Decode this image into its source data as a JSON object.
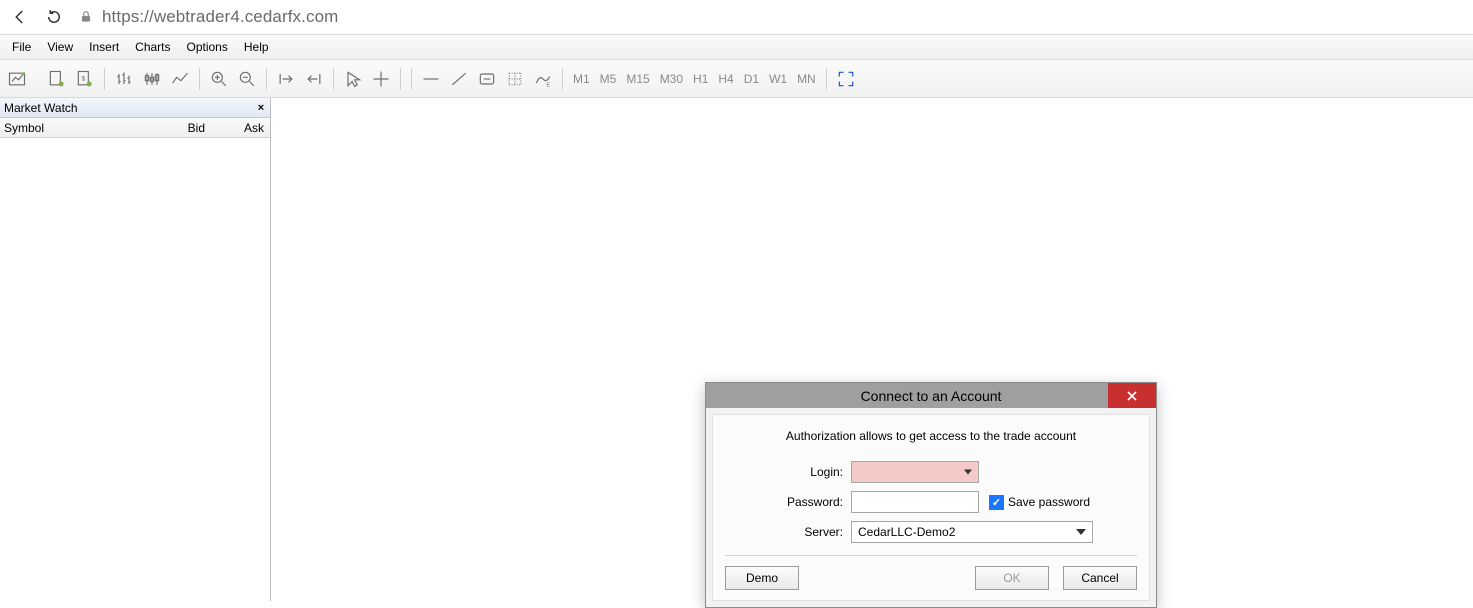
{
  "browser": {
    "url": "https://webtrader4.cedarfx.com"
  },
  "menu": {
    "items": [
      "File",
      "View",
      "Insert",
      "Charts",
      "Options",
      "Help"
    ]
  },
  "timeframes": [
    "M1",
    "M5",
    "M15",
    "M30",
    "H1",
    "H4",
    "D1",
    "W1",
    "MN"
  ],
  "market_watch": {
    "title": "Market Watch",
    "columns": {
      "symbol": "Symbol",
      "bid": "Bid",
      "ask": "Ask"
    }
  },
  "dialog": {
    "title": "Connect to an Account",
    "description": "Authorization allows to get access to the trade account",
    "labels": {
      "login": "Login:",
      "password": "Password:",
      "server": "Server:"
    },
    "save_password_label": "Save password",
    "save_password_checked": true,
    "server_value": "CedarLLC-Demo2",
    "buttons": {
      "demo": "Demo",
      "ok": "OK",
      "cancel": "Cancel"
    }
  }
}
